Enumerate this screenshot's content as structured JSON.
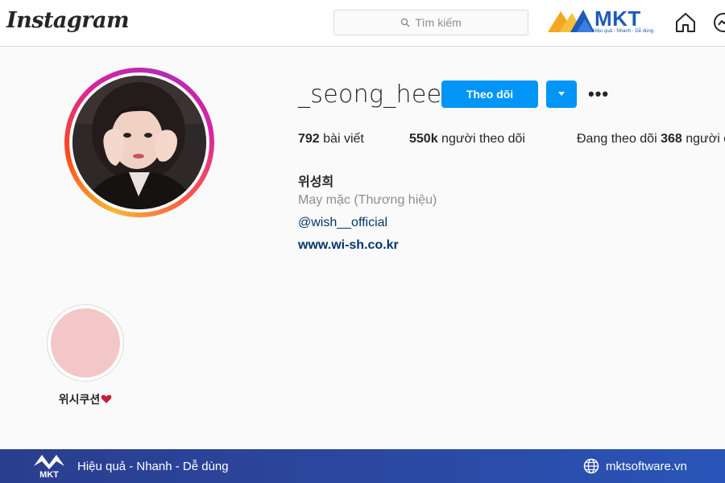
{
  "header": {
    "logo_text": "Instagram",
    "search_placeholder": "Tìm kiếm",
    "badge_brand": "MKT",
    "badge_tagline": "Hiệu quả - Nhanh - Dễ dùng"
  },
  "profile": {
    "username": "_seong_hee",
    "follow_label": "Theo dõi",
    "more_label": "•••",
    "stats": {
      "posts_count": "792",
      "posts_label": "bài viết",
      "followers_count": "550k",
      "followers_label": "người theo dõi",
      "following_label": "Đang theo dõi",
      "following_count": "368",
      "following_suffix": "người dùng"
    },
    "bio": {
      "name": "위성희",
      "category": "May mặc (Thương hiệu)",
      "tag": "@wish__official",
      "website": "www.wi-sh.co.kr"
    }
  },
  "highlights": [
    {
      "label": "위시쿠션",
      "color": "#f3c7c7"
    }
  ],
  "footer": {
    "slogan": "Hiệu quả - Nhanh - Dễ dùng",
    "website": "mktsoftware.vn"
  },
  "colors": {
    "primary_button": "#0095f6",
    "link": "#00376b",
    "footer_bg": "#2b47a0"
  }
}
